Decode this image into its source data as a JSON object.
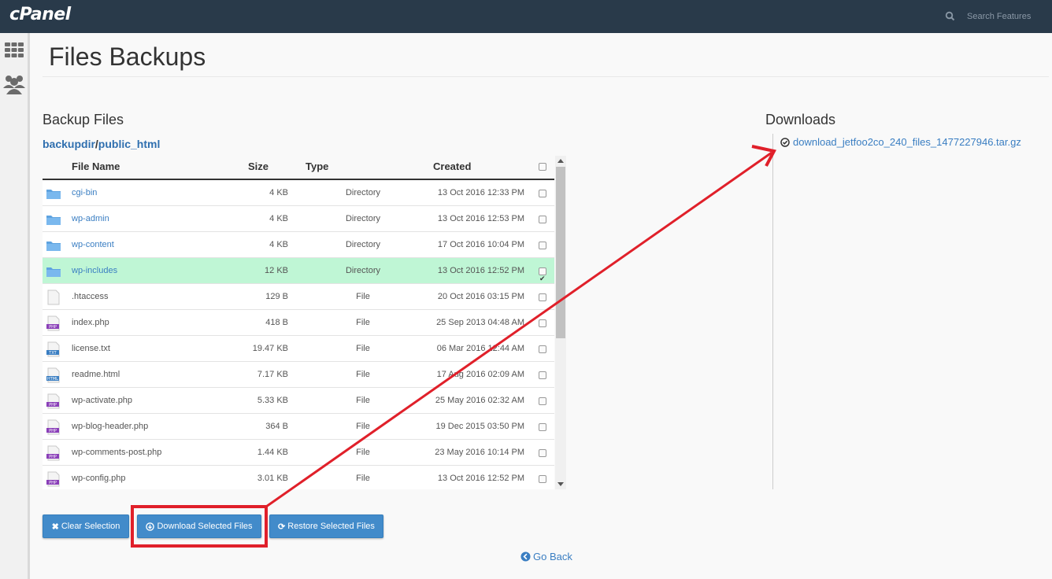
{
  "header": {
    "logo": "cPanel",
    "search_placeholder": "Search Features"
  },
  "page": {
    "title": "Files Backups"
  },
  "backup": {
    "section_title": "Backup Files",
    "path_root": "backupdir",
    "path_sep": "/",
    "path_leaf": "public_html",
    "columns": {
      "name": "File Name",
      "size": "Size",
      "type": "Type",
      "created": "Created"
    },
    "rows": [
      {
        "icon": "folder-icon",
        "name": "cgi-bin",
        "size": "4 KB",
        "type": "Directory",
        "created": "13 Oct 2016 12:33 PM",
        "checked": false,
        "link": true
      },
      {
        "icon": "folder-icon",
        "name": "wp-admin",
        "size": "4 KB",
        "type": "Directory",
        "created": "13 Oct 2016 12:53 PM",
        "checked": false,
        "link": true
      },
      {
        "icon": "folder-icon",
        "name": "wp-content",
        "size": "4 KB",
        "type": "Directory",
        "created": "17 Oct 2016 10:04 PM",
        "checked": false,
        "link": true
      },
      {
        "icon": "folder-icon",
        "name": "wp-includes",
        "size": "12 KB",
        "type": "Directory",
        "created": "13 Oct 2016 12:52 PM",
        "checked": true,
        "link": true
      },
      {
        "icon": "blank-file-icon",
        "name": ".htaccess",
        "size": "129 B",
        "type": "File",
        "created": "20 Oct 2016 03:15 PM",
        "checked": false,
        "link": false
      },
      {
        "icon": "php-file-icon",
        "name": "index.php",
        "size": "418 B",
        "type": "File",
        "created": "25 Sep 2013 04:48 AM",
        "checked": false,
        "link": false
      },
      {
        "icon": "txt-file-icon",
        "name": "license.txt",
        "size": "19.47 KB",
        "type": "File",
        "created": "06 Mar 2016 12:44 AM",
        "checked": false,
        "link": false
      },
      {
        "icon": "html-file-icon",
        "name": "readme.html",
        "size": "7.17 KB",
        "type": "File",
        "created": "17 Aug 2016 02:09 AM",
        "checked": false,
        "link": false
      },
      {
        "icon": "php-file-icon",
        "name": "wp-activate.php",
        "size": "5.33 KB",
        "type": "File",
        "created": "25 May 2016 02:32 AM",
        "checked": false,
        "link": false
      },
      {
        "icon": "php-file-icon",
        "name": "wp-blog-header.php",
        "size": "364 B",
        "type": "File",
        "created": "19 Dec 2015 03:50 PM",
        "checked": false,
        "link": false
      },
      {
        "icon": "php-file-icon",
        "name": "wp-comments-post.php",
        "size": "1.44 KB",
        "type": "File",
        "created": "23 May 2016 10:14 PM",
        "checked": false,
        "link": false
      },
      {
        "icon": "php-file-icon",
        "name": "wp-config.php",
        "size": "3.01 KB",
        "type": "File",
        "created": "13 Oct 2016 12:52 PM",
        "checked": false,
        "link": false
      }
    ]
  },
  "buttons": {
    "clear": "Clear Selection",
    "download": "Download Selected Files",
    "restore": "Restore Selected Files"
  },
  "go_back": "Go Back",
  "downloads": {
    "section_title": "Downloads",
    "items": [
      {
        "name": "download_jetfoo2co_240_files_1477227946.tar.gz",
        "icon": "check-circle-icon"
      }
    ]
  },
  "colors": {
    "topbar": "#293a4a",
    "link": "#3a7ec2",
    "button": "#428bca",
    "selected_row": "#bff6d5",
    "annotation": "#e0202a"
  }
}
